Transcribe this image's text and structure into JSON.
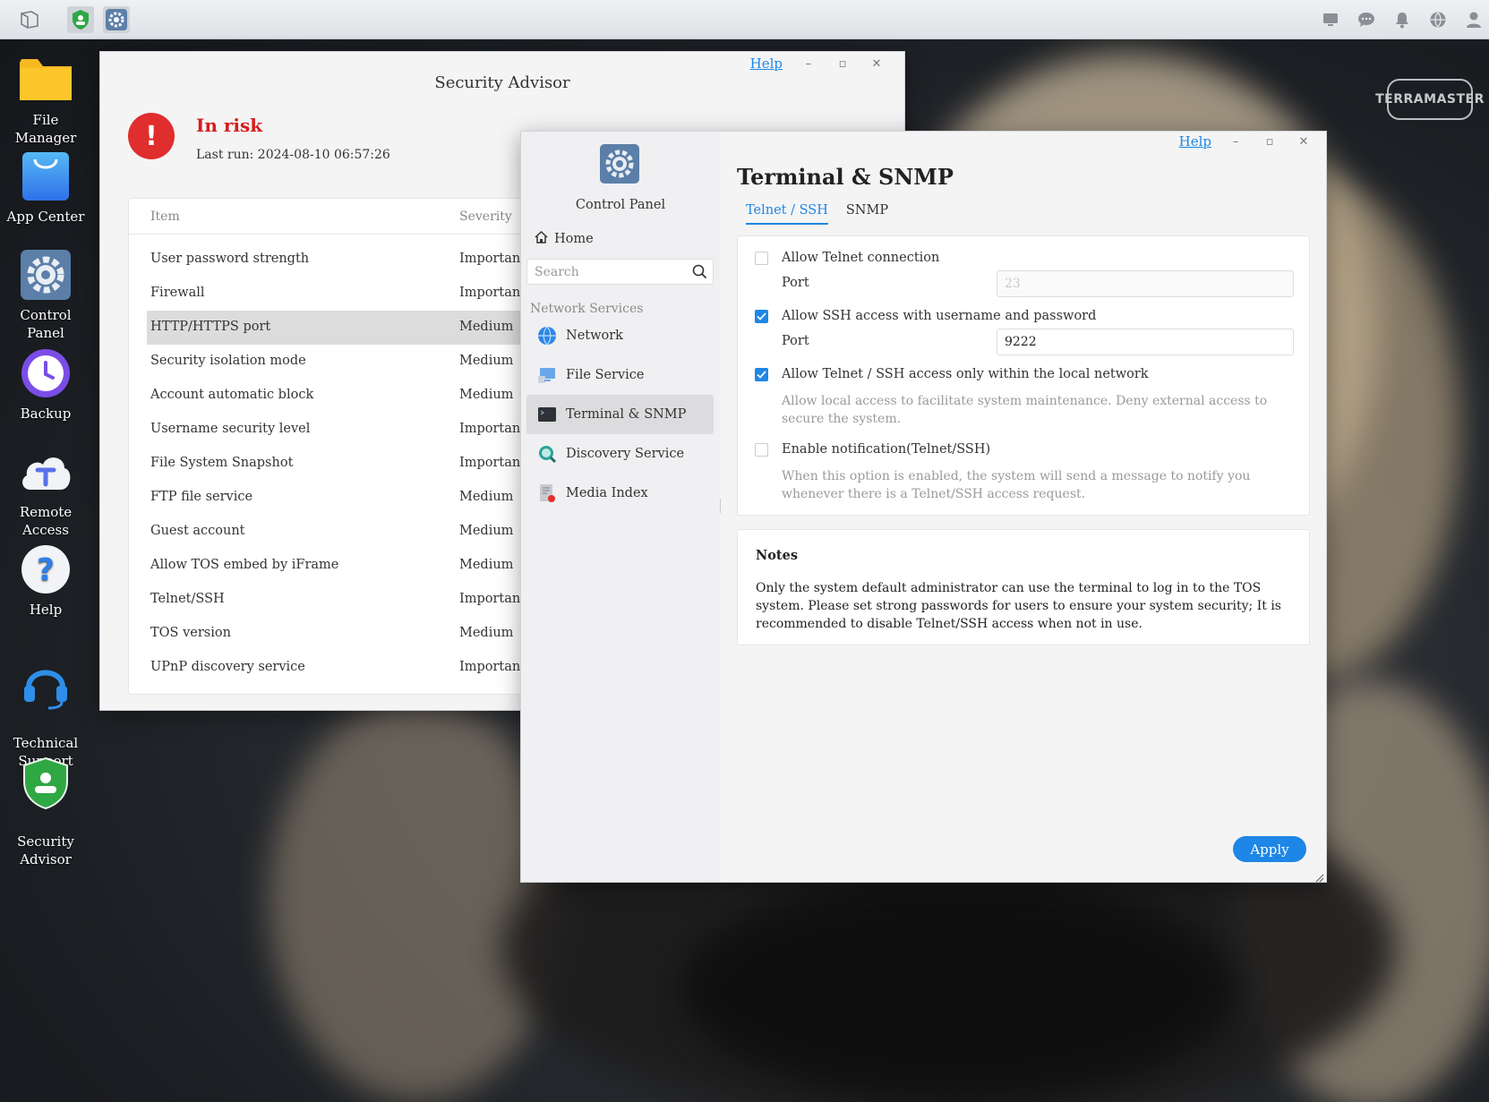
{
  "desktop": {
    "icons": [
      {
        "label": "File Manager"
      },
      {
        "label": "App Center"
      },
      {
        "label": "Control Panel"
      },
      {
        "label": "Backup"
      },
      {
        "label": "Remote Access"
      },
      {
        "label": "Help"
      },
      {
        "label": "Technical\nSupport"
      },
      {
        "label": "Security\nAdvisor"
      }
    ],
    "brand_logo": "TERRAMASTER"
  },
  "security_advisor": {
    "title": "Security Advisor",
    "help": "Help",
    "status": "In risk",
    "last_run": "Last run: 2024-08-10 06:57:26",
    "columns": {
      "item": "Item",
      "severity": "Severity"
    },
    "rows": [
      {
        "item": "User password strength",
        "severity": "Important"
      },
      {
        "item": "Firewall",
        "severity": "Important"
      },
      {
        "item": "HTTP/HTTPS port",
        "severity": "Medium"
      },
      {
        "item": "Security isolation mode",
        "severity": "Medium"
      },
      {
        "item": "Account automatic block",
        "severity": "Medium"
      },
      {
        "item": "Username security level",
        "severity": "Important"
      },
      {
        "item": "File System Snapshot",
        "severity": "Important"
      },
      {
        "item": "FTP file service",
        "severity": "Medium"
      },
      {
        "item": "Guest account",
        "severity": "Medium"
      },
      {
        "item": "Allow TOS embed by iFrame",
        "severity": "Medium"
      },
      {
        "item": "Telnet/SSH",
        "severity": "Important"
      },
      {
        "item": "TOS version",
        "severity": "Medium"
      },
      {
        "item": "UPnP discovery service",
        "severity": "Important"
      }
    ]
  },
  "control_panel": {
    "app_name": "Control Panel",
    "help": "Help",
    "home": "Home",
    "search_placeholder": "Search",
    "group": "Network Services",
    "nav": [
      {
        "label": "Network"
      },
      {
        "label": "File Service"
      },
      {
        "label": "Terminal & SNMP"
      },
      {
        "label": "Discovery Service"
      },
      {
        "label": "Media Index"
      }
    ],
    "page_title": "Terminal & SNMP",
    "tabs": [
      "Telnet / SSH",
      "SNMP"
    ],
    "telnet": {
      "allow_telnet": "Allow Telnet connection",
      "telnet_port_label": "Port",
      "telnet_port_placeholder": "23",
      "allow_ssh": "Allow SSH access with username and password",
      "ssh_port_label": "Port",
      "ssh_port_value": "9222",
      "local_only": "Allow Telnet / SSH access only within the local network",
      "local_only_hint": "Allow local access to facilitate system maintenance. Deny external access to secure the system.",
      "notify": "Enable notification(Telnet/SSH)",
      "notify_hint": "When this option is enabled, the system will send a message to notify you whenever there is a Telnet/SSH access request."
    },
    "notes": {
      "title": "Notes",
      "body": "Only the system default administrator can use the terminal to log in to the TOS system. Please set strong passwords for users to ensure your system security; It is recommended to disable Telnet/SSH access when not in use."
    },
    "apply": "Apply"
  }
}
